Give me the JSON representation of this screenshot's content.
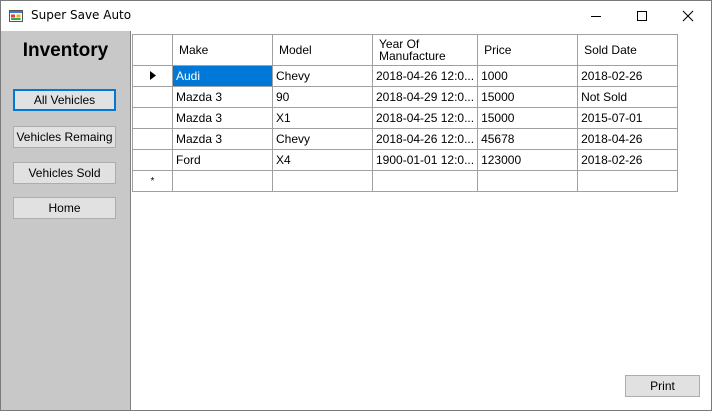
{
  "window": {
    "title": "Super Save Auto",
    "icon": "windows-forms-app-icon",
    "controls": [
      "minimize-icon",
      "maximize-icon",
      "close-icon"
    ]
  },
  "sidebar": {
    "title": "Inventory",
    "buttons": [
      {
        "label": "All Vehicles",
        "active": true
      },
      {
        "label": "Vehicles Remaing",
        "active": false
      },
      {
        "label": "Vehicles Sold",
        "active": false
      },
      {
        "label": "Home",
        "active": false
      }
    ]
  },
  "grid": {
    "columns": [
      "Make",
      "Model",
      "Year Of Manufacture",
      "Price",
      "Sold Date"
    ],
    "rows": [
      {
        "current": true,
        "cells": [
          "Audi",
          "Chevy",
          "2018-04-26 12:0...",
          "1000",
          "2018-02-26"
        ]
      },
      {
        "current": false,
        "cells": [
          "Mazda 3",
          "90",
          "2018-04-29 12:0...",
          "15000",
          "Not Sold"
        ]
      },
      {
        "current": false,
        "cells": [
          "Mazda 3",
          "X1",
          "2018-04-25 12:0...",
          "15000",
          "2015-07-01"
        ]
      },
      {
        "current": false,
        "cells": [
          "Mazda 3",
          "Chevy",
          "2018-04-26 12:0...",
          "45678",
          "2018-04-26"
        ]
      },
      {
        "current": false,
        "cells": [
          "Ford",
          "X4",
          "1900-01-01 12:0...",
          "123000",
          "2018-02-26"
        ]
      }
    ],
    "new_row_marker": "*",
    "selection_color": "#0078d7"
  },
  "actions": {
    "print_label": "Print"
  },
  "colors": {
    "sidebar_bg": "#c8c8c8",
    "button_bg": "#e1e1e1",
    "active_border": "#0078d7"
  }
}
